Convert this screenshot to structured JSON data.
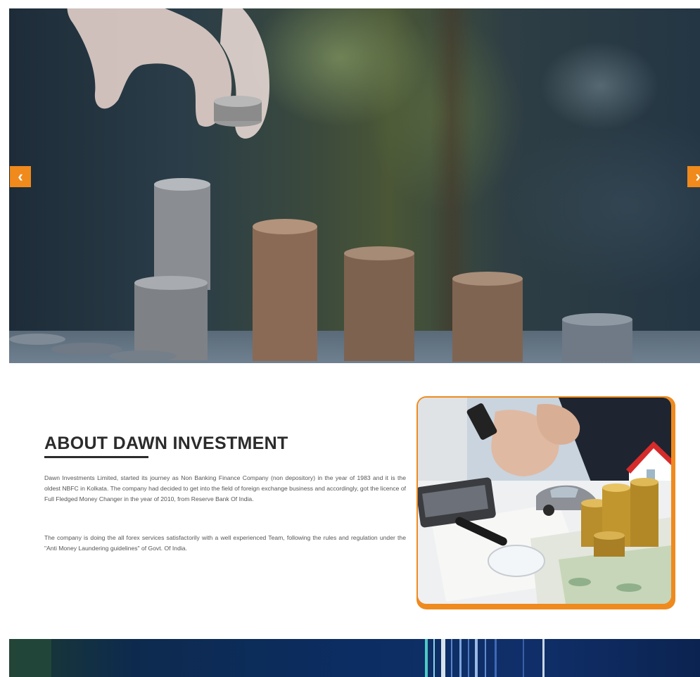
{
  "slider": {
    "prev_arrow": "‹",
    "next_arrow": "›"
  },
  "about": {
    "title": "ABOUT DAWN INVESTMENT",
    "paragraph_1": "Dawn Investments Limited, started its journey as Non Banking Finance Company (non depository) in the year of 1983 and it is the oldest NBFC in Kolkata. The company had decided to get into the field of foreign exchange business and accordingly, got the licence of Full Fledged Money Changer in the year of 2010, from Reserve Bank Of India.",
    "paragraph_2": "The company is doing the all forex services satisfactorily with a well experienced Team, following the rules and regulation under the \"Anti Money Laundering guidelines\" of Govt. Of India."
  },
  "colors": {
    "accent": "#f08a1c",
    "heading": "#2b2b2b",
    "body_text": "#555555"
  }
}
